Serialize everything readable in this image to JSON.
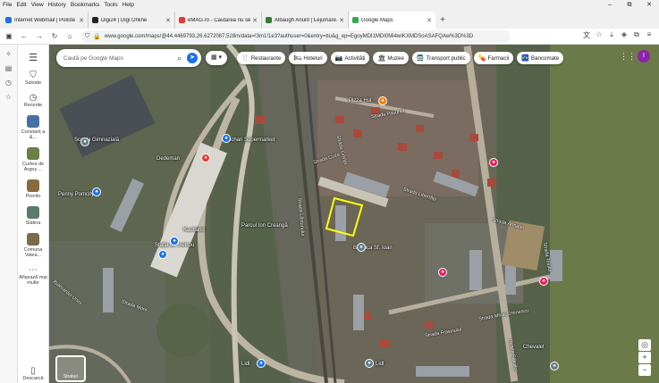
{
  "menubar": {
    "items": [
      "File",
      "Edit",
      "View",
      "History",
      "Bookmarks",
      "Tools",
      "Help"
    ]
  },
  "window_controls": [
    "–",
    "⧉",
    "✕"
  ],
  "tabs": [
    {
      "label": "Internet Webmail | Poliste",
      "color": "#1a73e8",
      "active": false
    },
    {
      "label": "Digi24 | Digi Online",
      "color": "#222222",
      "active": false
    },
    {
      "label": "eMAG.ro - Căutarea nu se opre",
      "color": "#e53935",
      "active": false
    },
    {
      "label": "Albaugh Anunt | Lejumare.ro",
      "color": "#2e7d32",
      "active": false
    },
    {
      "label": "Google Maps",
      "color": "#34a853",
      "active": true
    }
  ],
  "url": "www.google.com/maps/@44.4469793,26.6272087,528m/data=!3m1!1e3?authuser=0&entry=ttu&g_ep=EgoyMDI1MDI0Mi4wIKXMDSoASAFQAw%3D%3D",
  "browser_sidebar_icons": [
    "gear-icon",
    "reader-icon",
    "history-icon",
    "star-icon"
  ],
  "gmaps_sidebar": {
    "saved": "Salvate",
    "recent": "Recente",
    "places": [
      {
        "label": "Constanț a &...",
        "color": "#4a6fa5"
      },
      {
        "label": "Curtea de Argeș ...",
        "color": "#6b7f4a"
      },
      {
        "label": "Pionito",
        "color": "#8a6a3c"
      },
      {
        "label": "Slatina",
        "color": "#5b7b6b"
      },
      {
        "label": "Comuna Valea...",
        "color": "#7a6b4f"
      }
    ],
    "more": "Afișează mai multe",
    "download": "Descarcă"
  },
  "search": {
    "placeholder": "Caută pe Google Maps"
  },
  "chips": [
    {
      "icon": "🍴",
      "label": "Restaurante"
    },
    {
      "icon": "🛏",
      "label": "Hoteluri"
    },
    {
      "icon": "📷",
      "label": "Activități"
    },
    {
      "icon": "🏛",
      "label": "Muzee"
    },
    {
      "icon": "🚍",
      "label": "Transport public"
    },
    {
      "icon": "💊",
      "label": "Farmacii"
    },
    {
      "icon": "🏧",
      "label": "Bancomate"
    }
  ],
  "avatar_letter": "I",
  "map_type_label": "Straturi",
  "map_labels": {
    "poi1": "Școala Gimnazială",
    "poi2": "Auchan Supermarket",
    "poi3": "Dedeman",
    "poi4": "Penny Pomcity",
    "poi5": "Kaufland",
    "poi6": "Parcul Ion Creangă",
    "poi7": "Stația de metrou",
    "poi8": "Lidl",
    "poi9": "Biserica Sf. Ioan",
    "poi10": "Lidl",
    "poi11": "Chevalet",
    "poi12": "Pizza Hut"
  },
  "streets": {
    "s1": "Strada Pașunei",
    "s2": "Strada Grivița",
    "s3": "Strada Cuza",
    "s4": "Strada Libertății",
    "s5": "Strada Armatei",
    "s6": "Strada Lăstunului",
    "s7": "Bulevardul Unirii",
    "s8": "Strada Teiului",
    "s9": "Strada Morii",
    "s10": "Strada Mihai Eminescu",
    "s11": "Strada Frasinului",
    "s12": "Strada Sălciilor"
  }
}
